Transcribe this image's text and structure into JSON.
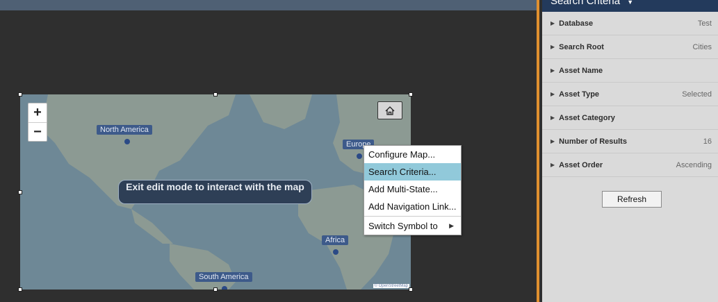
{
  "map": {
    "zoom_in": "+",
    "zoom_out": "−",
    "edit_notice": "Exit edit mode to interact with the map",
    "attribution": "© OpenStreetMap",
    "regions": [
      "North America",
      "Europe",
      "Africa",
      "South America"
    ]
  },
  "context_menu": {
    "items": [
      "Configure Map...",
      "Search Criteria...",
      "Add Multi-State...",
      "Add Navigation Link...",
      "Switch Symbol to"
    ],
    "active_index": 1
  },
  "panel": {
    "title": "Search Criteria",
    "rows": [
      {
        "label": "Database",
        "value": "Test"
      },
      {
        "label": "Search Root",
        "value": "Cities"
      },
      {
        "label": "Asset Name",
        "value": ""
      },
      {
        "label": "Asset Type",
        "value": "Selected"
      },
      {
        "label": "Asset Category",
        "value": ""
      },
      {
        "label": "Number of Results",
        "value": "16"
      },
      {
        "label": "Asset Order",
        "value": "Ascending"
      }
    ],
    "refresh_label": "Refresh"
  },
  "colors": {
    "panel_header": "#233a5c",
    "menu_highlight": "#91c9da",
    "splitter_accent": "#e0902f"
  }
}
